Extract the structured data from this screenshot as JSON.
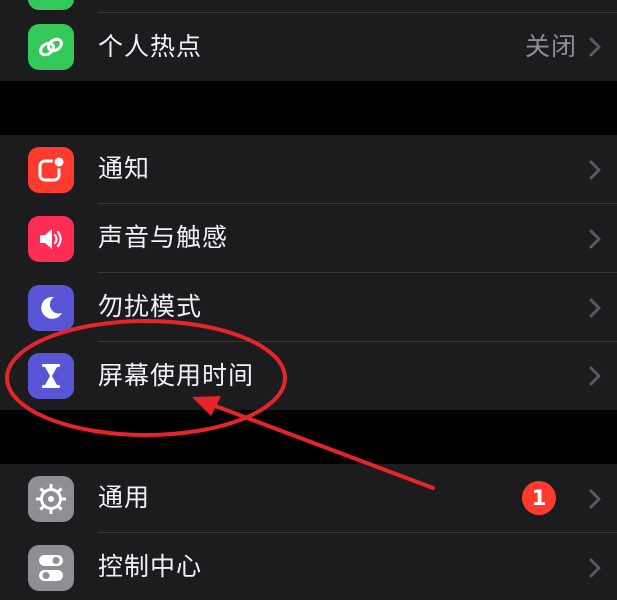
{
  "groups": [
    {
      "rows": [
        {
          "label": "个人热点",
          "value": "关闭",
          "icon": "hotspot-icon",
          "icon_color": "#34c759"
        }
      ]
    },
    {
      "rows": [
        {
          "label": "通知",
          "icon": "notifications-icon",
          "icon_color": "#ff3b30"
        },
        {
          "label": "声音与触感",
          "icon": "sound-icon",
          "icon_color": "#ff2d55"
        },
        {
          "label": "勿扰模式",
          "icon": "moon-icon",
          "icon_color": "#5856d6"
        },
        {
          "label": "屏幕使用时间",
          "icon": "hourglass-icon",
          "icon_color": "#5856d6"
        }
      ]
    },
    {
      "rows": [
        {
          "label": "通用",
          "badge": "1",
          "icon": "gear-icon",
          "icon_color": "#8e8e93"
        },
        {
          "label": "控制中心",
          "icon": "switches-icon",
          "icon_color": "#8e8e93"
        }
      ]
    }
  ],
  "annotation": {
    "color": "#e5252a",
    "target": "屏幕使用时间"
  }
}
